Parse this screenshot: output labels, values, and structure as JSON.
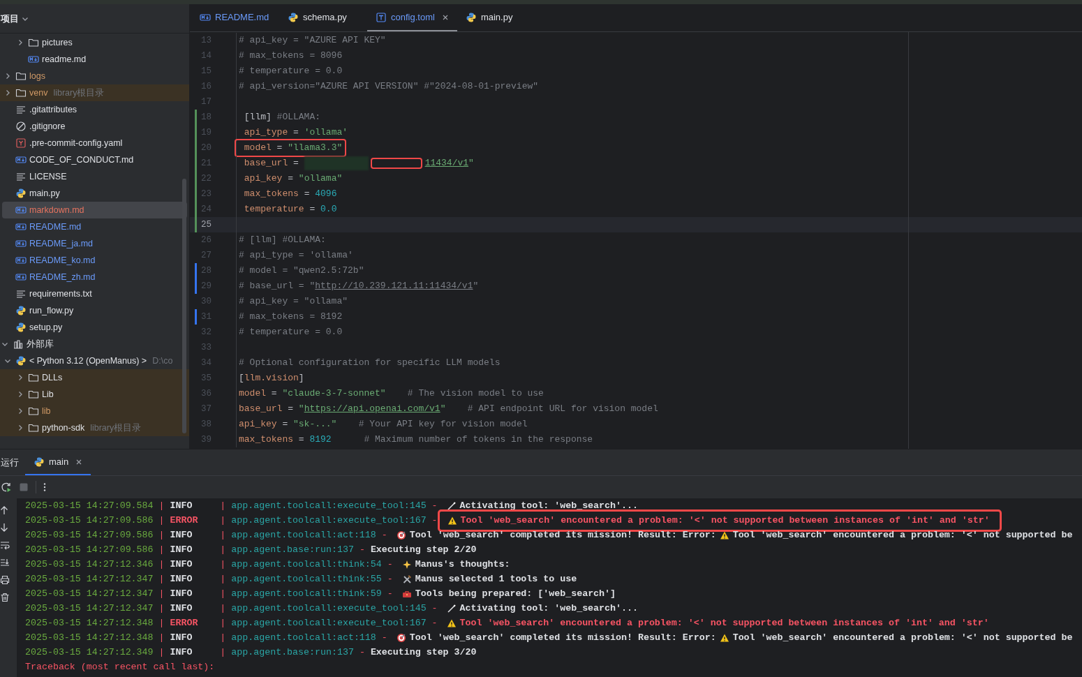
{
  "sidebar": {
    "title": "项目",
    "tree": [
      {
        "children": [
          {
            "children": [
              {
                "label": "pictures",
                "kind": "folder",
                "color": "#dfe1e5",
                "expanded": false,
                "selected": false,
                "highlighted": false
              },
              {
                "label": "readme.md",
                "kind": "markdown",
                "color": "#dfe1e5",
                "selected": false,
                "highlighted": false
              }
            ]
          },
          {
            "label": "logs",
            "kind": "folder",
            "color": "#d19a66",
            "expanded": false,
            "selected": false,
            "highlighted": false
          },
          {
            "label": "venv",
            "hint": "library根目录",
            "kind": "folder",
            "color": "#d19a66",
            "expanded": false,
            "selected": false,
            "highlighted": true
          },
          {
            "label": ".gitattributes",
            "kind": "text",
            "color": "#dfe1e5",
            "selected": false,
            "highlighted": false
          },
          {
            "label": ".gitignore",
            "kind": "ignore",
            "color": "#dfe1e5",
            "selected": false,
            "highlighted": false
          },
          {
            "label": ".pre-commit-config.yaml",
            "kind": "yaml",
            "color": "#dfe1e5",
            "selected": false,
            "highlighted": false
          },
          {
            "label": "CODE_OF_CONDUCT.md",
            "kind": "markdown",
            "color": "#dfe1e5",
            "selected": false,
            "highlighted": false
          },
          {
            "label": "LICENSE",
            "kind": "text",
            "color": "#dfe1e5",
            "selected": false,
            "highlighted": false
          },
          {
            "label": "main.py",
            "kind": "python",
            "color": "#dfe1e5",
            "selected": false,
            "highlighted": false
          },
          {
            "label": "markdown.md",
            "kind": "markdown",
            "color": "#e5735f",
            "selected": true,
            "highlighted": false
          },
          {
            "label": "README.md",
            "kind": "markdown",
            "color": "#6b9bfa",
            "selected": false,
            "highlighted": false
          },
          {
            "label": "README_ja.md",
            "kind": "markdown",
            "color": "#6b9bfa",
            "selected": false,
            "highlighted": false
          },
          {
            "label": "README_ko.md",
            "kind": "markdown",
            "color": "#6b9bfa",
            "selected": false,
            "highlighted": false
          },
          {
            "label": "README_zh.md",
            "kind": "markdown",
            "color": "#6b9bfa",
            "selected": false,
            "highlighted": false
          },
          {
            "label": "requirements.txt",
            "kind": "text",
            "color": "#dfe1e5",
            "selected": false,
            "highlighted": false
          },
          {
            "label": "run_flow.py",
            "kind": "python",
            "color": "#dfe1e5",
            "selected": false,
            "highlighted": false
          },
          {
            "label": "setup.py",
            "kind": "python",
            "color": "#dfe1e5",
            "selected": false,
            "highlighted": false
          }
        ]
      },
      {
        "label": "外部库",
        "kind": "library",
        "color": "#dfe1e5",
        "expanded": true,
        "selected": false,
        "highlighted": false,
        "children": [
          {
            "label": "< Python 3.12 (OpenManus) >",
            "hint": "D:\\co",
            "kind": "python",
            "color": "#dfe1e5",
            "expanded": true,
            "selected": false,
            "highlighted": false,
            "children": [
              {
                "label": "DLLs",
                "kind": "folder",
                "color": "#dfe1e5",
                "expanded": false,
                "selected": false,
                "highlighted": true
              },
              {
                "label": "Lib",
                "kind": "folder",
                "color": "#dfe1e5",
                "expanded": false,
                "selected": false,
                "highlighted": true
              },
              {
                "label": "lib",
                "kind": "folder",
                "color": "#d19a66",
                "expanded": false,
                "selected": false,
                "highlighted": true
              },
              {
                "label": "python-sdk",
                "hint": "library根目录",
                "kind": "folder",
                "color": "#dfe1e5",
                "expanded": false,
                "selected": false,
                "highlighted": true
              }
            ]
          }
        ]
      }
    ]
  },
  "editor": {
    "tabs": [
      {
        "label": "README.md",
        "kind": "markdown",
        "color": "#6b9bfa",
        "selected": false
      },
      {
        "label": "schema.py",
        "kind": "python",
        "color": "#dfe1e5",
        "selected": false
      },
      {
        "label": "config.toml",
        "kind": "toml",
        "color": "#6b9bfa",
        "selected": true
      },
      {
        "label": "main.py",
        "kind": "python",
        "color": "#dfe1e5",
        "selected": false
      }
    ],
    "lines": [
      {
        "number": "13",
        "current": false,
        "marked": false,
        "segments": [
          {
            "kind": "comment",
            "text": "# api_key = \"AZURE API KEY\""
          }
        ]
      },
      {
        "number": "14",
        "current": false,
        "marked": false,
        "segments": [
          {
            "kind": "comment",
            "text": "# max_tokens = 8096"
          }
        ]
      },
      {
        "number": "15",
        "current": false,
        "marked": false,
        "segments": [
          {
            "kind": "comment",
            "text": "# temperature = 0.0"
          }
        ]
      },
      {
        "number": "16",
        "current": false,
        "marked": false,
        "segments": [
          {
            "kind": "comment",
            "text": "# api_version=\"AZURE API VERSION\" #\"2024-08-01-preview\""
          }
        ]
      },
      {
        "number": "17",
        "current": false
      },
      {
        "number": "18",
        "color": "#549159",
        "current": false,
        "marked": false,
        "segments": [
          {
            "kind": "plain",
            "text": " [llm] "
          },
          {
            "kind": "comment",
            "text": "#OLLAMA:"
          }
        ]
      },
      {
        "number": "19",
        "color": "#549159",
        "current": false,
        "marked": false,
        "segments": [
          {
            "kind": "key",
            "text": " api_type"
          },
          {
            "kind": "op",
            "text": " = "
          },
          {
            "kind": "str",
            "text": "'ollama'"
          }
        ]
      },
      {
        "number": "20",
        "color": "#549159",
        "current": false,
        "marked": true,
        "segments": [
          {
            "kind": "key",
            "text": " model"
          },
          {
            "kind": "op",
            "text": " = "
          },
          {
            "kind": "str",
            "text": "\"llama3.3\""
          }
        ]
      },
      {
        "number": "21",
        "color": "#549159",
        "current": false,
        "marked": false,
        "segments": [
          {
            "kind": "key",
            "text": " base_url"
          },
          {
            "kind": "op",
            "text": " = "
          },
          {
            "kind": "redacted"
          },
          {
            "kind": "link",
            "text": "11434/v1"
          },
          {
            "kind": "str",
            "text": "\""
          }
        ]
      },
      {
        "number": "22",
        "color": "#549159",
        "current": false,
        "marked": false,
        "segments": [
          {
            "kind": "key",
            "text": " api_key"
          },
          {
            "kind": "op",
            "text": " = "
          },
          {
            "kind": "str",
            "text": "\"ollama\""
          }
        ]
      },
      {
        "number": "23",
        "color": "#549159",
        "current": false,
        "marked": false,
        "segments": [
          {
            "kind": "key",
            "text": " max_tokens"
          },
          {
            "kind": "op",
            "text": " = "
          },
          {
            "kind": "num",
            "text": "4096"
          }
        ]
      },
      {
        "number": "24",
        "color": "#549159",
        "current": false,
        "marked": false,
        "segments": [
          {
            "kind": "key",
            "text": " temperature"
          },
          {
            "kind": "op",
            "text": " = "
          },
          {
            "kind": "num",
            "text": "0.0"
          }
        ]
      },
      {
        "number": "25",
        "color": "#549159",
        "current": true
      },
      {
        "number": "26",
        "current": false,
        "marked": false,
        "segments": [
          {
            "kind": "comment",
            "text": "# [llm] #OLLAMA:"
          }
        ]
      },
      {
        "number": "27",
        "current": false,
        "marked": false,
        "segments": [
          {
            "kind": "comment",
            "text": "# api_type = 'ollama'"
          }
        ]
      },
      {
        "number": "28",
        "color": "#3574f0",
        "current": false,
        "marked": false,
        "segments": [
          {
            "kind": "comment",
            "text": "# model = \"qwen2.5:72b\""
          }
        ]
      },
      {
        "number": "29",
        "color": "#3574f0",
        "current": false,
        "marked": false,
        "segments": [
          {
            "kind": "comment",
            "text": "# base_url = \""
          },
          {
            "kind": "clink",
            "text": "http://10.239.121.11:11434/v1"
          },
          {
            "kind": "comment",
            "text": "\""
          }
        ]
      },
      {
        "number": "30",
        "current": false,
        "marked": false,
        "segments": [
          {
            "kind": "comment",
            "text": "# api_key = \"ollama\""
          }
        ]
      },
      {
        "number": "31",
        "color": "#3574f0",
        "current": false,
        "marked": false,
        "segments": [
          {
            "kind": "comment",
            "text": "# max_tokens = 8192"
          }
        ]
      },
      {
        "number": "32",
        "current": false,
        "marked": false,
        "segments": [
          {
            "kind": "comment",
            "text": "# temperature = 0.0"
          }
        ]
      },
      {
        "number": "33",
        "current": false
      },
      {
        "number": "34",
        "current": false,
        "marked": false,
        "segments": [
          {
            "kind": "comment",
            "text": "# Optional configuration for specific LLM models"
          }
        ]
      },
      {
        "number": "35",
        "current": false,
        "marked": false,
        "segments": [
          {
            "kind": "plain",
            "text": "["
          },
          {
            "kind": "table",
            "text": "llm.vision"
          },
          {
            "kind": "plain",
            "text": "]"
          }
        ]
      },
      {
        "number": "36",
        "current": false,
        "marked": false,
        "segments": [
          {
            "kind": "key",
            "text": "model"
          },
          {
            "kind": "op",
            "text": " = "
          },
          {
            "kind": "str",
            "text": "\"claude-3-7-sonnet\""
          },
          {
            "kind": "comment",
            "text": "    # The vision model to use"
          }
        ]
      },
      {
        "number": "37",
        "current": false,
        "marked": false,
        "segments": [
          {
            "kind": "key",
            "text": "base_url"
          },
          {
            "kind": "op",
            "text": " = "
          },
          {
            "kind": "str",
            "text": "\""
          },
          {
            "kind": "link",
            "text": "https://api.openai.com/v1"
          },
          {
            "kind": "str",
            "text": "\""
          },
          {
            "kind": "comment",
            "text": "    # API endpoint URL for vision model"
          }
        ]
      },
      {
        "number": "38",
        "current": false,
        "marked": false,
        "segments": [
          {
            "kind": "key",
            "text": "api_key"
          },
          {
            "kind": "op",
            "text": " = "
          },
          {
            "kind": "str",
            "text": "\"sk-...\""
          },
          {
            "kind": "comment",
            "text": "    # Your API key for vision model"
          }
        ]
      },
      {
        "number": "39",
        "current": false,
        "marked": false,
        "segments": [
          {
            "kind": "key",
            "text": "max_tokens"
          },
          {
            "kind": "op",
            "text": " = "
          },
          {
            "kind": "num",
            "text": "8192"
          },
          {
            "kind": "comment",
            "text": "      # Maximum number of tokens in the response"
          }
        ]
      }
    ]
  },
  "run_panel": {
    "title": "运行",
    "tabs": [
      {
        "label": "main",
        "kind": "python",
        "selected": true
      }
    ],
    "logs": [
      {
        "kind": "info",
        "marked": false,
        "time": "2025-03-15 14:27:09.584",
        "separators": [
          "|",
          "|",
          "-"
        ],
        "level": "INFO",
        "source": "app.agent.toolcall:execute_tool:145",
        "parts": [
          {
            "kind": "wand"
          },
          {
            "kind": "text",
            "text": "Activating tool: 'web_search'..."
          }
        ]
      },
      {
        "kind": "error",
        "marked": true,
        "time": "2025-03-15 14:27:09.586",
        "separators": [
          "|",
          "|",
          "-"
        ],
        "level": "ERROR",
        "source": "app.agent.toolcall:execute_tool:167",
        "parts": [
          {
            "kind": "warning"
          },
          {
            "kind": "text",
            "text": "Tool 'web_search' encountered a problem: '<' not supported between instances of 'int' and 'str'"
          }
        ]
      },
      {
        "kind": "info",
        "marked": false,
        "time": "2025-03-15 14:27:09.586",
        "separators": [
          "|",
          "|",
          "-"
        ],
        "level": "INFO",
        "source": "app.agent.toolcall:act:118",
        "parts": [
          {
            "kind": "target"
          },
          {
            "kind": "text",
            "text": "Tool 'web_search' completed its mission! Result: Error:"
          },
          {
            "kind": "warning"
          },
          {
            "kind": "text",
            "text": "Tool 'web_search' encountered a problem: '<' not supported be"
          }
        ]
      },
      {
        "kind": "info",
        "marked": false,
        "time": "2025-03-15 14:27:09.586",
        "separators": [
          "|",
          "|",
          "-"
        ],
        "level": "INFO",
        "source": "app.agent.base:run:137",
        "parts": [
          {
            "kind": "text",
            "text": "Executing step 2/20"
          }
        ]
      },
      {
        "kind": "info",
        "marked": false,
        "time": "2025-03-15 14:27:12.346",
        "separators": [
          "|",
          "|",
          "-"
        ],
        "level": "INFO",
        "source": "app.agent.toolcall:think:54",
        "parts": [
          {
            "kind": "sparkle"
          },
          {
            "kind": "text",
            "text": "Manus's thoughts:"
          }
        ]
      },
      {
        "kind": "info",
        "marked": false,
        "time": "2025-03-15 14:27:12.347",
        "separators": [
          "|",
          "|",
          "-"
        ],
        "level": "INFO",
        "source": "app.agent.toolcall:think:55",
        "parts": [
          {
            "kind": "tools"
          },
          {
            "kind": "text",
            "text": "Manus selected 1 tools to use"
          }
        ]
      },
      {
        "kind": "info",
        "marked": false,
        "time": "2025-03-15 14:27:12.347",
        "separators": [
          "|",
          "|",
          "-"
        ],
        "level": "INFO",
        "source": "app.agent.toolcall:think:59",
        "parts": [
          {
            "kind": "toolbox"
          },
          {
            "kind": "text",
            "text": "Tools being prepared: ['web_search']"
          }
        ]
      },
      {
        "kind": "info",
        "marked": false,
        "time": "2025-03-15 14:27:12.347",
        "separators": [
          "|",
          "|",
          "-"
        ],
        "level": "INFO",
        "source": "app.agent.toolcall:execute_tool:145",
        "parts": [
          {
            "kind": "wand"
          },
          {
            "kind": "text",
            "text": "Activating tool: 'web_search'..."
          }
        ]
      },
      {
        "kind": "error",
        "marked": false,
        "time": "2025-03-15 14:27:12.348",
        "separators": [
          "|",
          "|",
          "-"
        ],
        "level": "ERROR",
        "source": "app.agent.toolcall:execute_tool:167",
        "parts": [
          {
            "kind": "warning"
          },
          {
            "kind": "text",
            "text": "Tool 'web_search' encountered a problem: '<' not supported between instances of 'int' and 'str'"
          }
        ]
      },
      {
        "kind": "info",
        "marked": false,
        "time": "2025-03-15 14:27:12.348",
        "separators": [
          "|",
          "|",
          "-"
        ],
        "level": "INFO",
        "source": "app.agent.toolcall:act:118",
        "parts": [
          {
            "kind": "target"
          },
          {
            "kind": "text",
            "text": "Tool 'web_search' completed its mission! Result: Error:"
          },
          {
            "kind": "warning"
          },
          {
            "kind": "text",
            "text": "Tool 'web_search' encountered a problem: '<' not supported be"
          }
        ]
      },
      {
        "kind": "info",
        "marked": false,
        "time": "2025-03-15 14:27:12.349",
        "separators": [
          "|",
          "|",
          "-"
        ],
        "level": "INFO",
        "source": "app.agent.base:run:137",
        "parts": [
          {
            "kind": "text",
            "text": "Executing step 3/20"
          }
        ]
      },
      {
        "kind": "traceback",
        "text": "Traceback (most recent call last):"
      }
    ]
  }
}
